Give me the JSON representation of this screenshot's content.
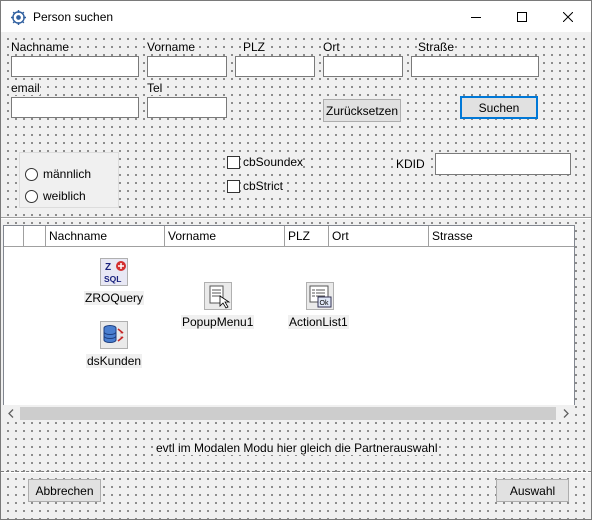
{
  "window": {
    "title": "Person suchen",
    "icon": "gear-app-icon"
  },
  "titlebar_buttons": [
    "minimize-icon",
    "maximize-icon",
    "close-icon"
  ],
  "fields": {
    "nachname": {
      "label": "Nachname",
      "value": ""
    },
    "vorname": {
      "label": "Vorname",
      "value": ""
    },
    "plz": {
      "label": "PLZ",
      "value": ""
    },
    "ort": {
      "label": "Ort",
      "value": ""
    },
    "strasse": {
      "label": "Straße",
      "value": ""
    },
    "email": {
      "label": "email",
      "value": ""
    },
    "tel": {
      "label": "Tel",
      "value": ""
    },
    "kdid": {
      "label": "KDID",
      "value": ""
    }
  },
  "buttons": {
    "reset": "Zurücksetzen",
    "search": "Suchen",
    "cancel": "Abbrechen",
    "select": "Auswahl"
  },
  "gender": {
    "options": [
      "männlich",
      "weiblich"
    ],
    "selected": null
  },
  "checkboxes": {
    "soundex": {
      "label": "cbSoundex",
      "checked": false
    },
    "strict": {
      "label": "cbStrict",
      "checked": false
    }
  },
  "grid": {
    "columns": [
      "",
      "Nachname",
      "Vorname",
      "PLZ",
      "Ort",
      "Strasse"
    ]
  },
  "components": {
    "zroquery": "ZROQuery",
    "popupmenu": "PopupMenu1",
    "actionlist": "ActionList1",
    "dskunden": "dsKunden",
    "zroquery_glyph_top": "Z",
    "zroquery_glyph_bottom": "SQL",
    "actionlist_glyph": "Ok"
  },
  "note": "evtl im Modalen Modu hier gleich die Partnerauswahl",
  "colors": {
    "accent": "#0078d7",
    "window_bg": "#f0f0f0"
  }
}
